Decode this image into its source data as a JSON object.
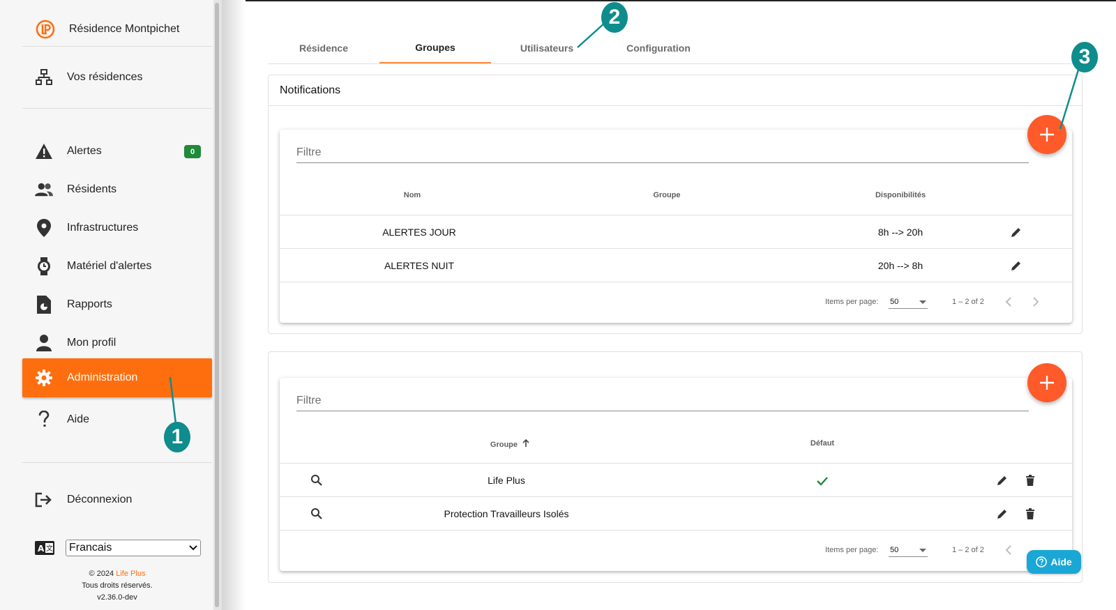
{
  "sidebar": {
    "brand": "Résidence Montpichet",
    "residences_link": "Vos résidences",
    "items": [
      {
        "label": "Alertes",
        "icon": "warning-icon",
        "badge": "0"
      },
      {
        "label": "Résidents",
        "icon": "people-icon"
      },
      {
        "label": "Infrastructures",
        "icon": "location-pin-icon"
      },
      {
        "label": "Matériel d'alertes",
        "icon": "watch-icon"
      },
      {
        "label": "Rapports",
        "icon": "report-icon"
      },
      {
        "label": "Mon profil",
        "icon": "person-icon"
      },
      {
        "label": "Administration",
        "icon": "gear-icon",
        "active": true
      },
      {
        "label": "Aide",
        "icon": "question-icon"
      }
    ],
    "logout": "Déconnexion",
    "language": "Francais",
    "footer": {
      "copyright_prefix": "© 2024 ",
      "brand": "Life Plus",
      "rights": "Tous droits réservés.",
      "version": "v2.36.0-dev"
    }
  },
  "tabs": [
    {
      "label": "Résidence"
    },
    {
      "label": "Groupes",
      "active": true
    },
    {
      "label": "Utilisateurs"
    },
    {
      "label": "Configuration"
    }
  ],
  "notifications_panel": {
    "title": "Notifications",
    "filter_placeholder": "Filtre",
    "columns": [
      "Nom",
      "Groupe",
      "Disponibilités"
    ],
    "rows": [
      {
        "nom": "ALERTES JOUR",
        "groupe": "",
        "dispo": "8h --> 20h"
      },
      {
        "nom": "ALERTES NUIT",
        "groupe": "",
        "dispo": "20h --> 8h"
      }
    ],
    "paginator": {
      "items_label": "Items per page:",
      "page_size": "50",
      "range": "1 – 2 of 2"
    }
  },
  "groups_panel": {
    "filter_placeholder": "Filtre",
    "columns": [
      "Groupe",
      "Défaut"
    ],
    "sort_icon": "arrow-up-icon",
    "rows": [
      {
        "groupe": "Life Plus",
        "defaut": true
      },
      {
        "groupe": "Protection Travailleurs Isolés",
        "defaut": false
      }
    ],
    "paginator": {
      "items_label": "Items per page:",
      "page_size": "50",
      "range": "1 – 2 of 2"
    }
  },
  "annotations": [
    "1",
    "2",
    "3"
  ],
  "help_button": "Aide",
  "colors": {
    "accent": "#ff6e0e",
    "fab": "#ff5a2a",
    "badge": "#1e8a3a",
    "annotation": "#0f8c8c",
    "help": "#1aa7d6",
    "check": "#1e8a3a"
  }
}
